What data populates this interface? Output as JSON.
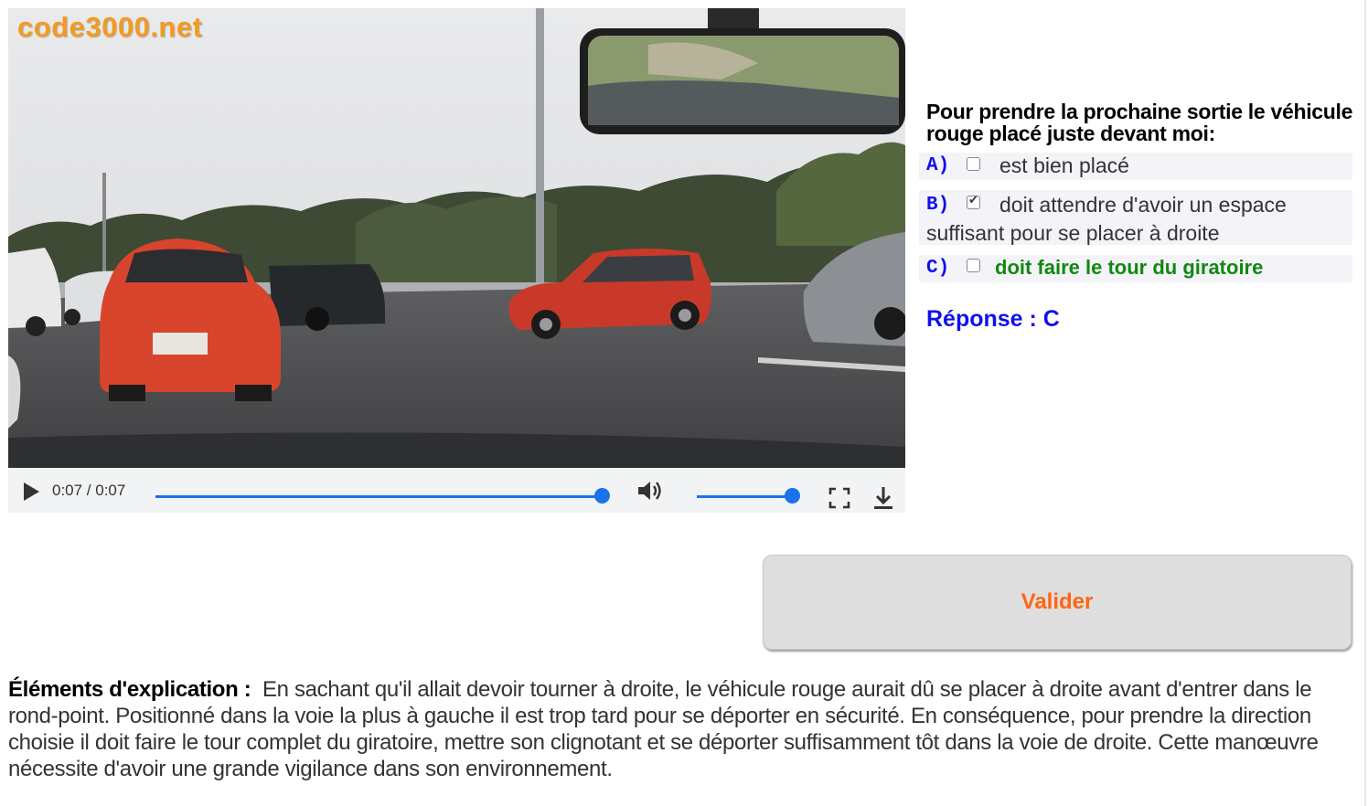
{
  "video": {
    "watermark": "code3000.net",
    "time": "0:07 / 0:07",
    "progress": 1.0,
    "volume": 1.0
  },
  "question": {
    "text": "Pour prendre la prochaine sortie le véhicule rouge placé juste devant moi:",
    "options": [
      {
        "letter": "A)",
        "text": "est bien placé",
        "checked": false,
        "correct": false
      },
      {
        "letter": "B)",
        "text": "doit attendre d'avoir un espace suffisant pour se placer à droite",
        "checked": true,
        "correct": false
      },
      {
        "letter": "C)",
        "text": "doit faire le tour du giratoire",
        "checked": false,
        "correct": true
      }
    ],
    "answer": "Réponse : C"
  },
  "validate_label": "Valider",
  "explanation": {
    "label": "Éléments d'explication :",
    "text": "En sachant qu'il allait devoir tourner à droite, le véhicule rouge aurait dû se placer à droite avant d'entrer dans le rond-point. Positionné dans la voie la plus à gauche il est trop tard pour se déporter en sécurité. En conséquence, pour prendre la direction choisie il doit faire le tour complet du giratoire, mettre son clignotant et se déporter suffisamment tôt dans la voie de droite. Cette manœuvre nécessite d'avoir une grande vigilance dans son environnement."
  },
  "colors": {
    "option_letter": "#1010ee",
    "correct_option": "#118811",
    "answer": "#1010ee",
    "validate_text": "#ff6611",
    "player_accent": "#1a73e8"
  }
}
